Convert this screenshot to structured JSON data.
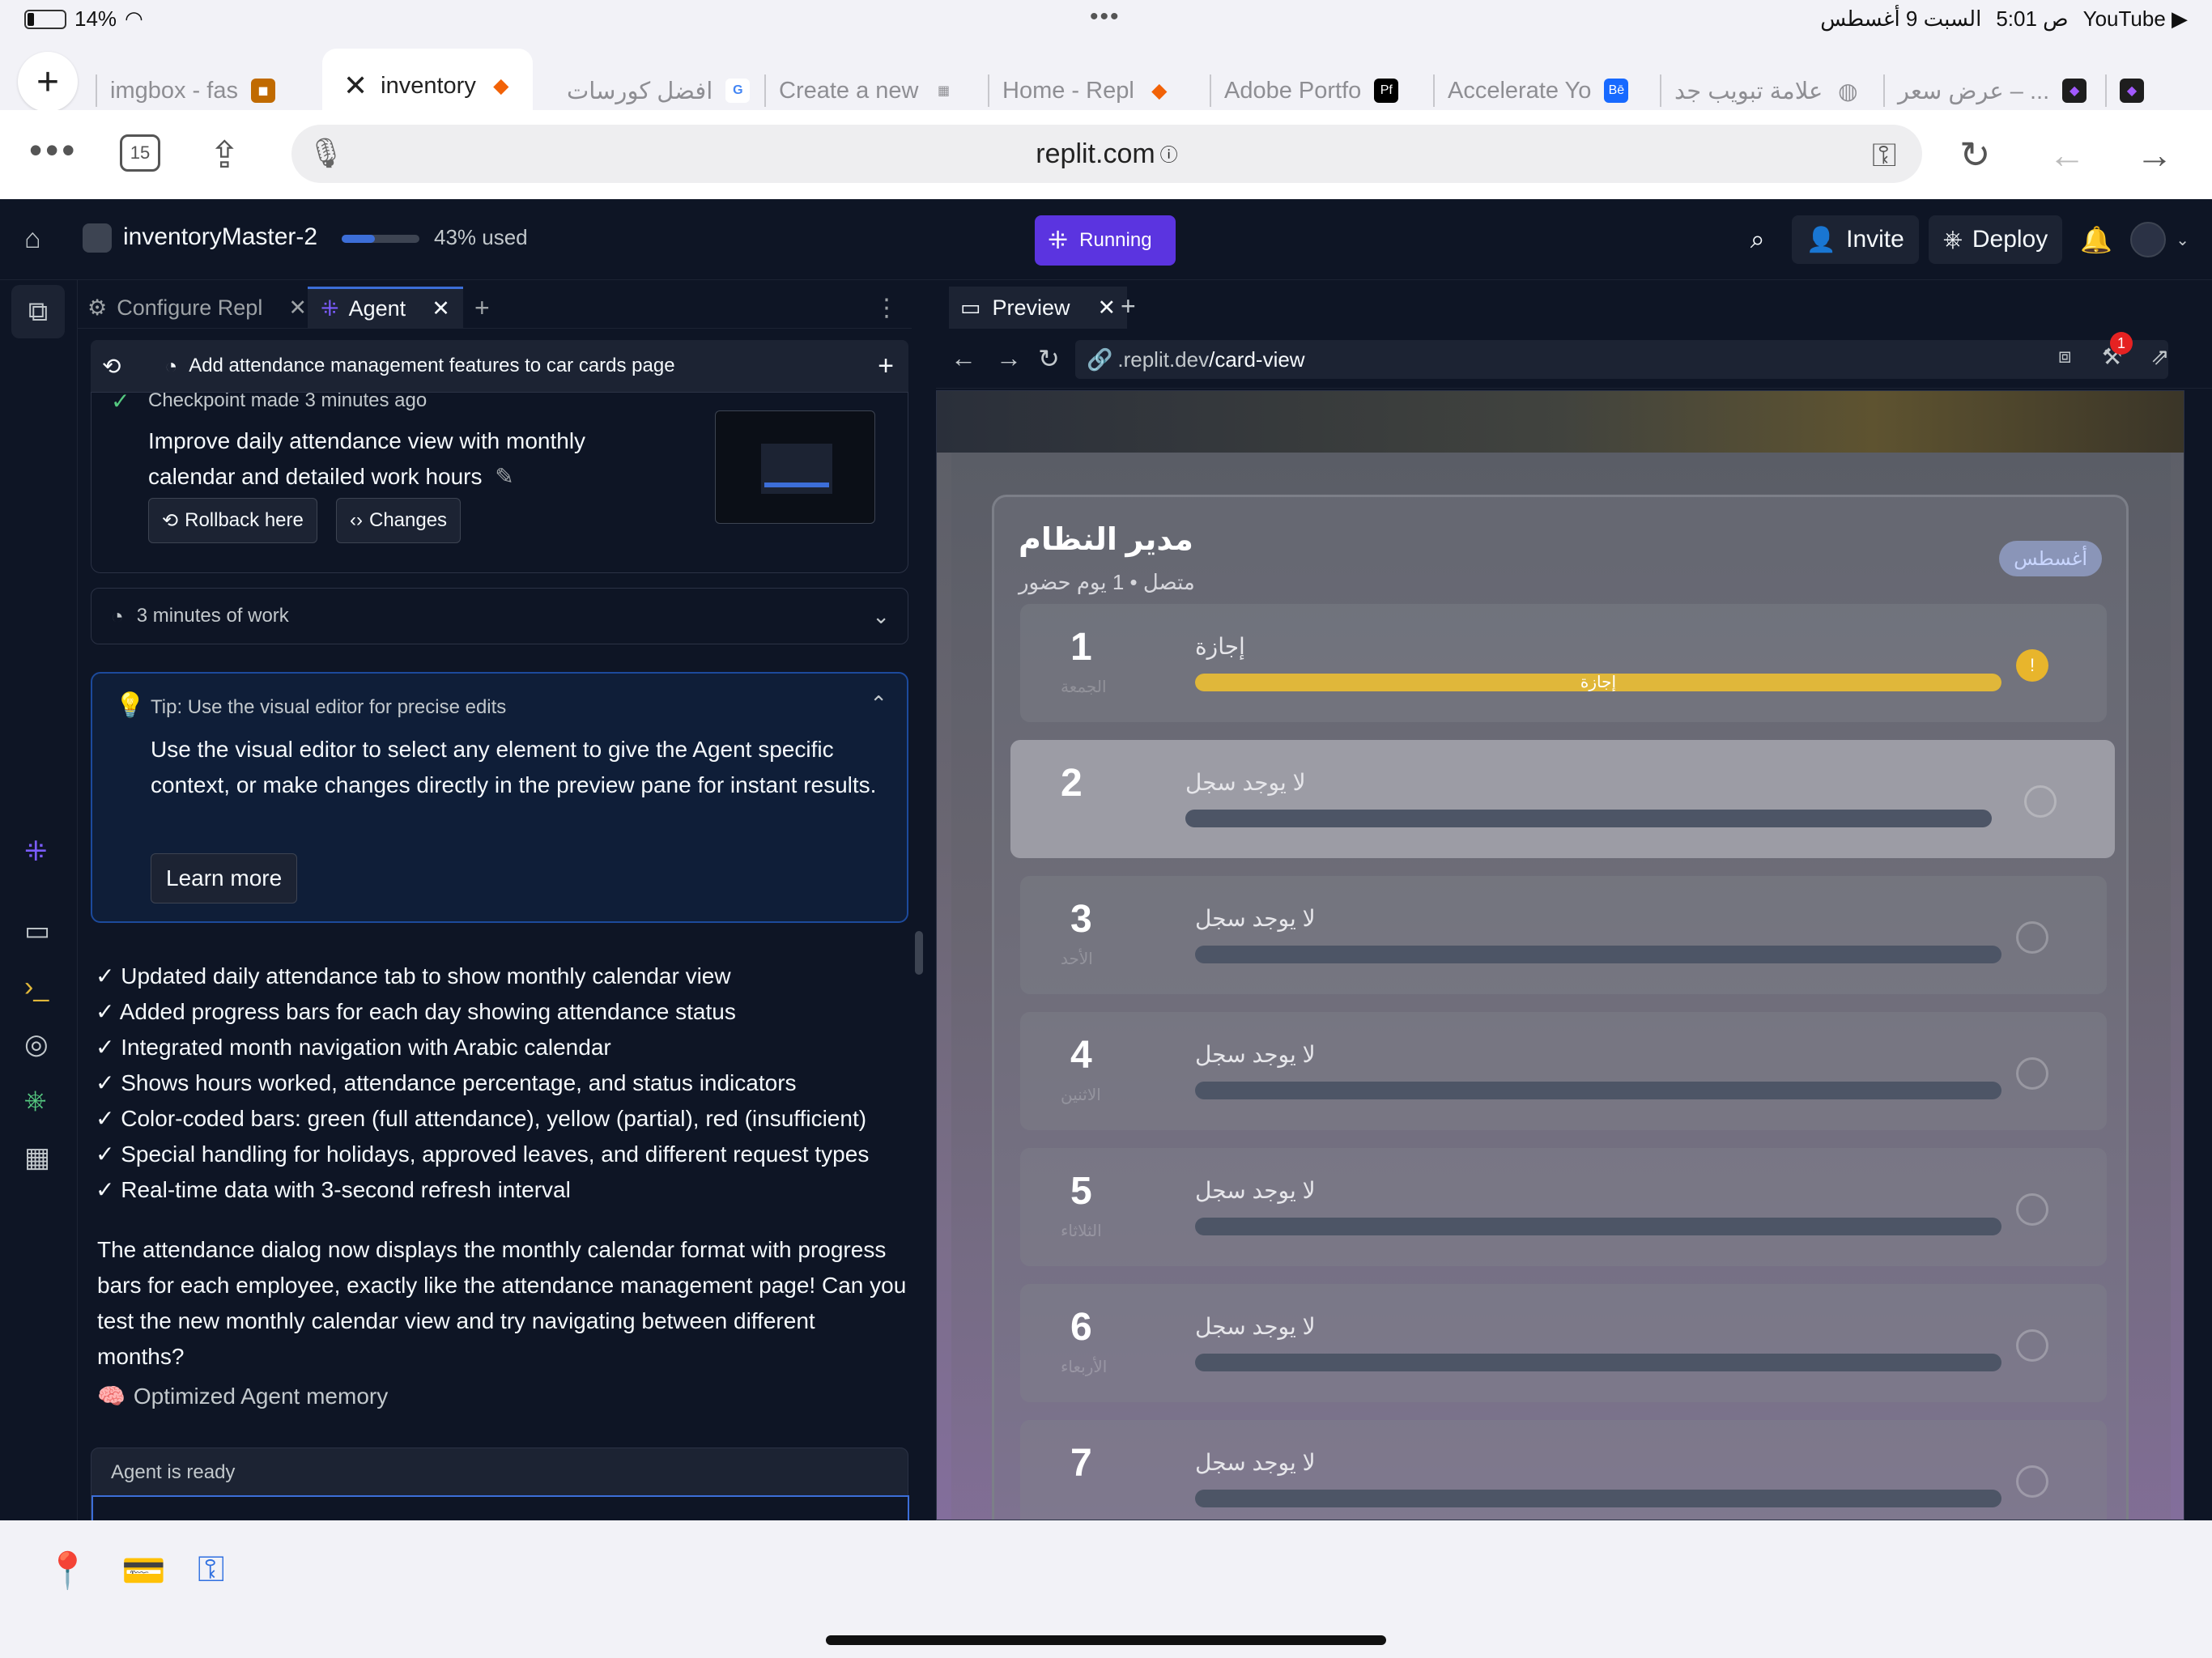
{
  "status": {
    "battery": "14%",
    "dots": "•••",
    "time": "5:01 ص",
    "date": "السبت 9 أغسطس",
    "app": "YouTube ▶"
  },
  "browser": {
    "tabs": [
      {
        "label": "imgbox - fas",
        "fav": "◼",
        "favcolor": "#c06a00"
      },
      {
        "label": "inventory",
        "fav": "⬥",
        "favcolor": "#f26207"
      },
      {
        "label": "افضل كورسات",
        "fav": "G",
        "favcolor": "#4285f4"
      },
      {
        "label": "Create a new",
        "fav": "▦",
        "favcolor": "#8e8e93"
      },
      {
        "label": "Home - Repl",
        "fav": "⬥",
        "favcolor": "#f26207"
      },
      {
        "label": "Adobe Portfo",
        "fav": "Pf",
        "favcolor": "#000000"
      },
      {
        "label": "Accelerate Yo",
        "fav": "Bē",
        "favcolor": "#1769ff"
      },
      {
        "label": "علامة تبويب جد",
        "fav": "◍",
        "favcolor": "#8e8e93"
      },
      {
        "label": "عرض سعر – ...",
        "fav": "◆",
        "favcolor": "#a259ff"
      }
    ],
    "tab_count": "15",
    "url": "replit.com"
  },
  "replit": {
    "project": "inventoryMaster-2",
    "usage_percent": 43,
    "usage_label": "43% used",
    "run_status": "Running",
    "invite": "Invite",
    "deploy": "Deploy"
  },
  "leftpanel": {
    "tabs": [
      "Configure Repl",
      "Agent"
    ],
    "checkpoint_bar": "Add attendance management features to car cards page",
    "checkpoint_meta": "Checkpoint made 3 minutes ago",
    "checkpoint_title": "Improve daily attendance view with monthly calendar and detailed work hours",
    "rollback": "Rollback here",
    "changes": "Changes",
    "work": "3 minutes of work",
    "tip_head": "Tip: Use the visual editor for precise edits",
    "tip_body": "Use the visual editor to select any element to give the Agent specific context, or make changes directly in the preview pane for instant results.",
    "learn_more": "Learn more",
    "checks": [
      "✓ Updated daily attendance tab to show monthly calendar view",
      "✓ Added progress bars for each day showing attendance status",
      "✓ Integrated month navigation with Arabic calendar",
      "✓ Shows hours worked, attendance percentage, and status indicators",
      "✓ Color-coded bars: green (full attendance), yellow (partial), red (insufficient)",
      "✓ Special handling for holidays, approved leaves, and different request types",
      "✓ Real-time data with 3-second refresh interval"
    ],
    "summary": "The attendance dialog now displays the monthly calendar format with progress bars for each employee, exactly like the attendance management page! Can you test the new monthly calendar view and try navigating between different months?",
    "memory": "Optimized Agent memory",
    "ready": "Agent is ready"
  },
  "preview": {
    "tab": "Preview",
    "url_prefix": ".replit.dev",
    "url_path": "/card-view",
    "badge": "1",
    "title": "مدير النظام",
    "subtitle": "متصل • 1 يوم حضور",
    "month": "أغسطس",
    "days": [
      {
        "num": "1",
        "weekday": "الجمعة",
        "label": "إجازة",
        "fill": 1.0,
        "fill_text": "إجازة",
        "status": "!"
      },
      {
        "num": "2",
        "weekday": "",
        "label": "لا يوجد سجل",
        "fill": 0,
        "fill_text": "",
        "status": ""
      },
      {
        "num": "3",
        "weekday": "الأحد",
        "label": "لا يوجد سجل",
        "fill": 0,
        "fill_text": "",
        "status": ""
      },
      {
        "num": "4",
        "weekday": "الاثنين",
        "label": "لا يوجد سجل",
        "fill": 0,
        "fill_text": "",
        "status": ""
      },
      {
        "num": "5",
        "weekday": "الثلاثاء",
        "label": "لا يوجد سجل",
        "fill": 0,
        "fill_text": "",
        "status": ""
      },
      {
        "num": "6",
        "weekday": "الأربعاء",
        "label": "لا يوجد سجل",
        "fill": 0,
        "fill_text": "",
        "status": ""
      },
      {
        "num": "7",
        "weekday": "",
        "label": "لا يوجد سجل",
        "fill": 0,
        "fill_text": "",
        "status": ""
      }
    ]
  },
  "colors": {
    "accent": "#3c6ed8",
    "running": "#5b34e0",
    "leave": "#e0b73a"
  }
}
